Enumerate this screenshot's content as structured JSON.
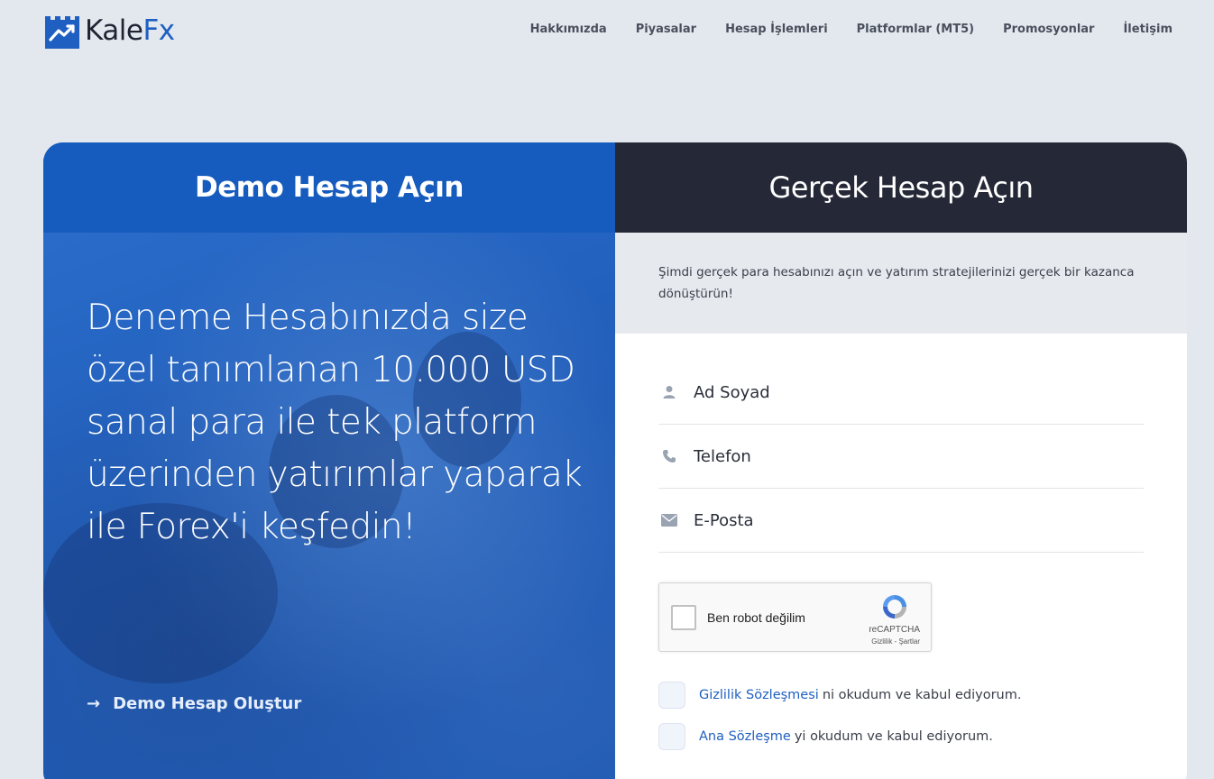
{
  "brand": {
    "name_part1": "Kale",
    "name_part2": "Fx",
    "accent": "#1e5fc1"
  },
  "nav": [
    {
      "label": "Hakkımızda"
    },
    {
      "label": "Piyasalar"
    },
    {
      "label": "Hesap İşlemleri"
    },
    {
      "label": "Platformlar (MT5)"
    },
    {
      "label": "Promosyonlar"
    },
    {
      "label": "İletişim"
    }
  ],
  "demo": {
    "title": "Demo Hesap Açın",
    "promo_text": "Deneme Hesabınızda size özel tanımlanan 10.000 USD sanal para ile tek platform üzerinden yatırımlar yaparak ile Forex'i keşfedin!",
    "link_label": "Demo Hesap Oluştur",
    "link_icon": "arrow-right-icon"
  },
  "real": {
    "title": "Gerçek Hesap Açın",
    "intro": "Şimdi gerçek para hesabınızı açın ve yatırım stratejilerinizi gerçek bir kazanca dönüştürün!",
    "fields": [
      {
        "placeholder": "Ad Soyad",
        "icon": "user-icon"
      },
      {
        "placeholder": "Telefon",
        "icon": "phone-icon"
      },
      {
        "placeholder": "E-Posta",
        "icon": "mail-icon"
      }
    ],
    "captcha": {
      "label": "Ben robot değilim",
      "brand": "reCAPTCHA",
      "links": "Gizlilik - Şartlar"
    },
    "agreements": [
      {
        "link": "Gizlilik Sözleşmesi",
        "text": "ni okudum ve kabul ediyorum."
      },
      {
        "link": "Ana Sözleşme",
        "text": "yi okudum ve kabul ediyorum."
      }
    ]
  }
}
